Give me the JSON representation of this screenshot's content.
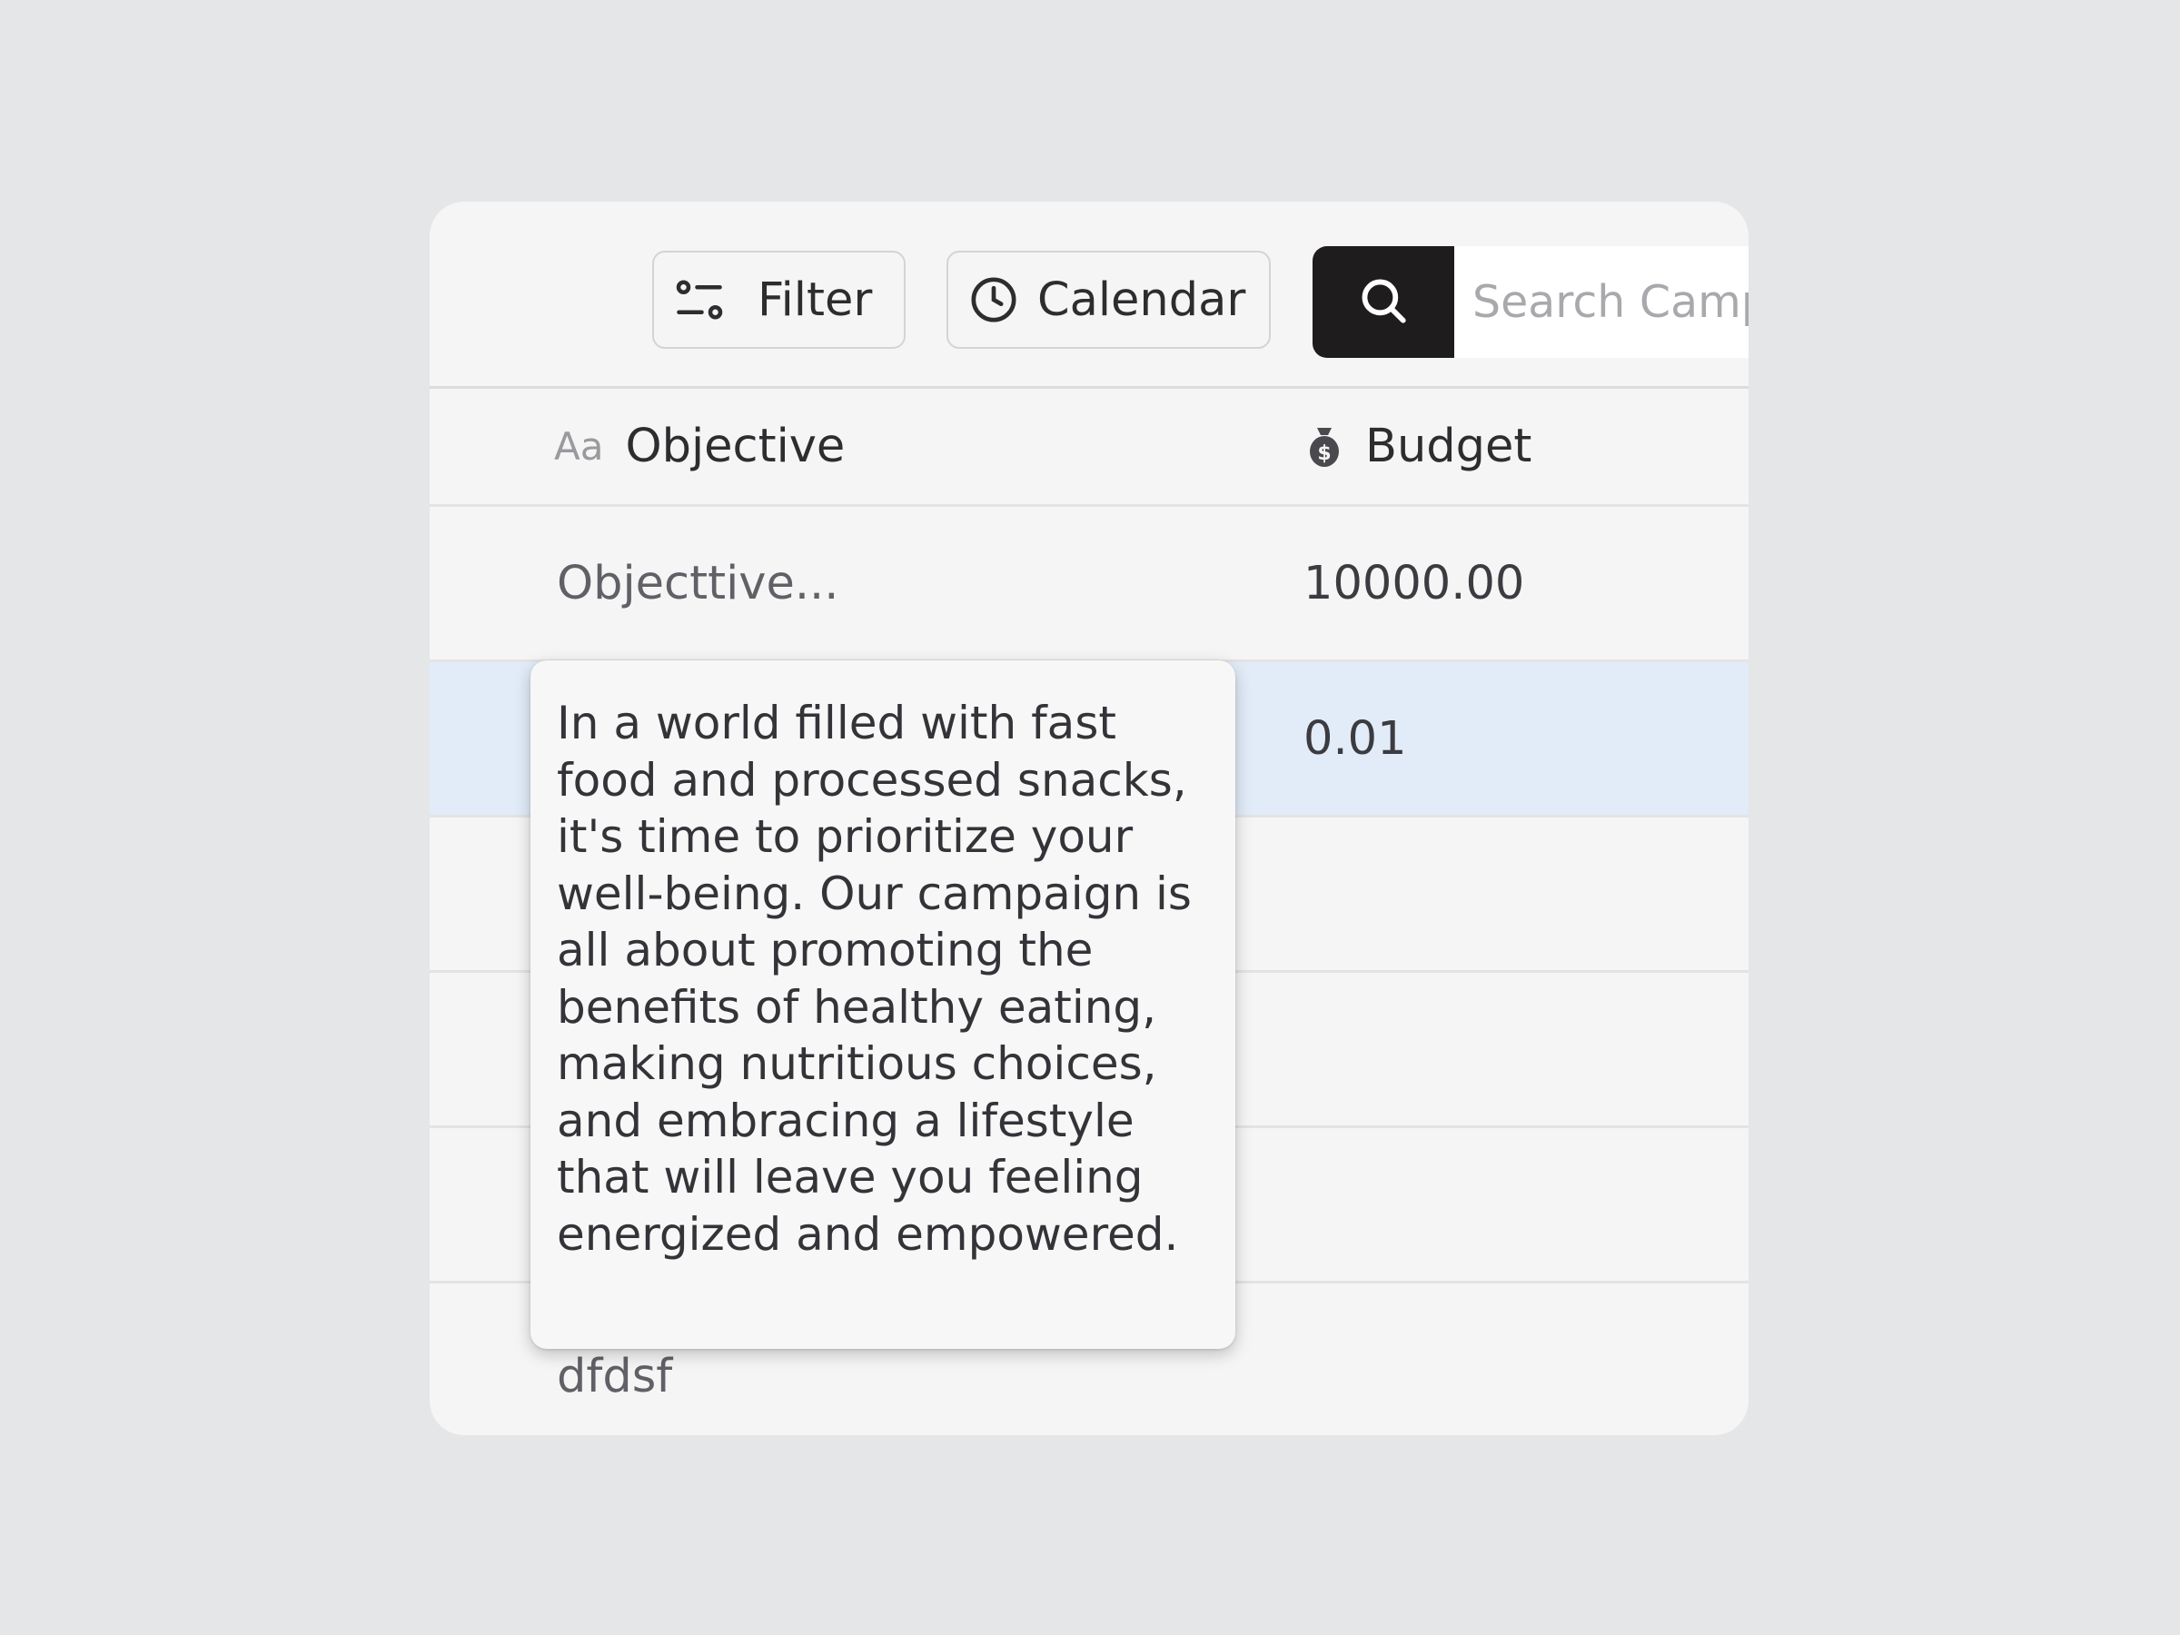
{
  "toolbar": {
    "filter_label": "Filter",
    "calendar_label": "Calendar",
    "search_placeholder": "Search Campaigns"
  },
  "table": {
    "columns": [
      {
        "icon": "text-type-icon",
        "icon_text": "Aa",
        "label": "Objective"
      },
      {
        "icon": "money-icon",
        "label": "Budget"
      }
    ],
    "rows": [
      {
        "objective": "Objecttive...",
        "budget": "10000.00",
        "selected": false
      },
      {
        "objective": "",
        "budget": "0.01",
        "selected": true
      },
      {
        "objective": "",
        "budget": "",
        "selected": false
      },
      {
        "objective": "",
        "budget": "",
        "selected": false
      },
      {
        "objective": "",
        "budget": "",
        "selected": false
      },
      {
        "objective": "dfdsf",
        "budget": "",
        "selected": false
      }
    ]
  },
  "tooltip": {
    "text": "In a world filled with fast food and processed snacks, it's time to prioritize your well-being. Our campaign is all about promoting the benefits of healthy eating, making nutritious choices, and embracing a lifestyle that will leave you feeling energized and empowered."
  },
  "colors": {
    "page_background": "#e5e6e8",
    "card_background": "#f5f5f5",
    "search_button": "#1e1c1c",
    "selected_row": "#e1ecf8"
  }
}
